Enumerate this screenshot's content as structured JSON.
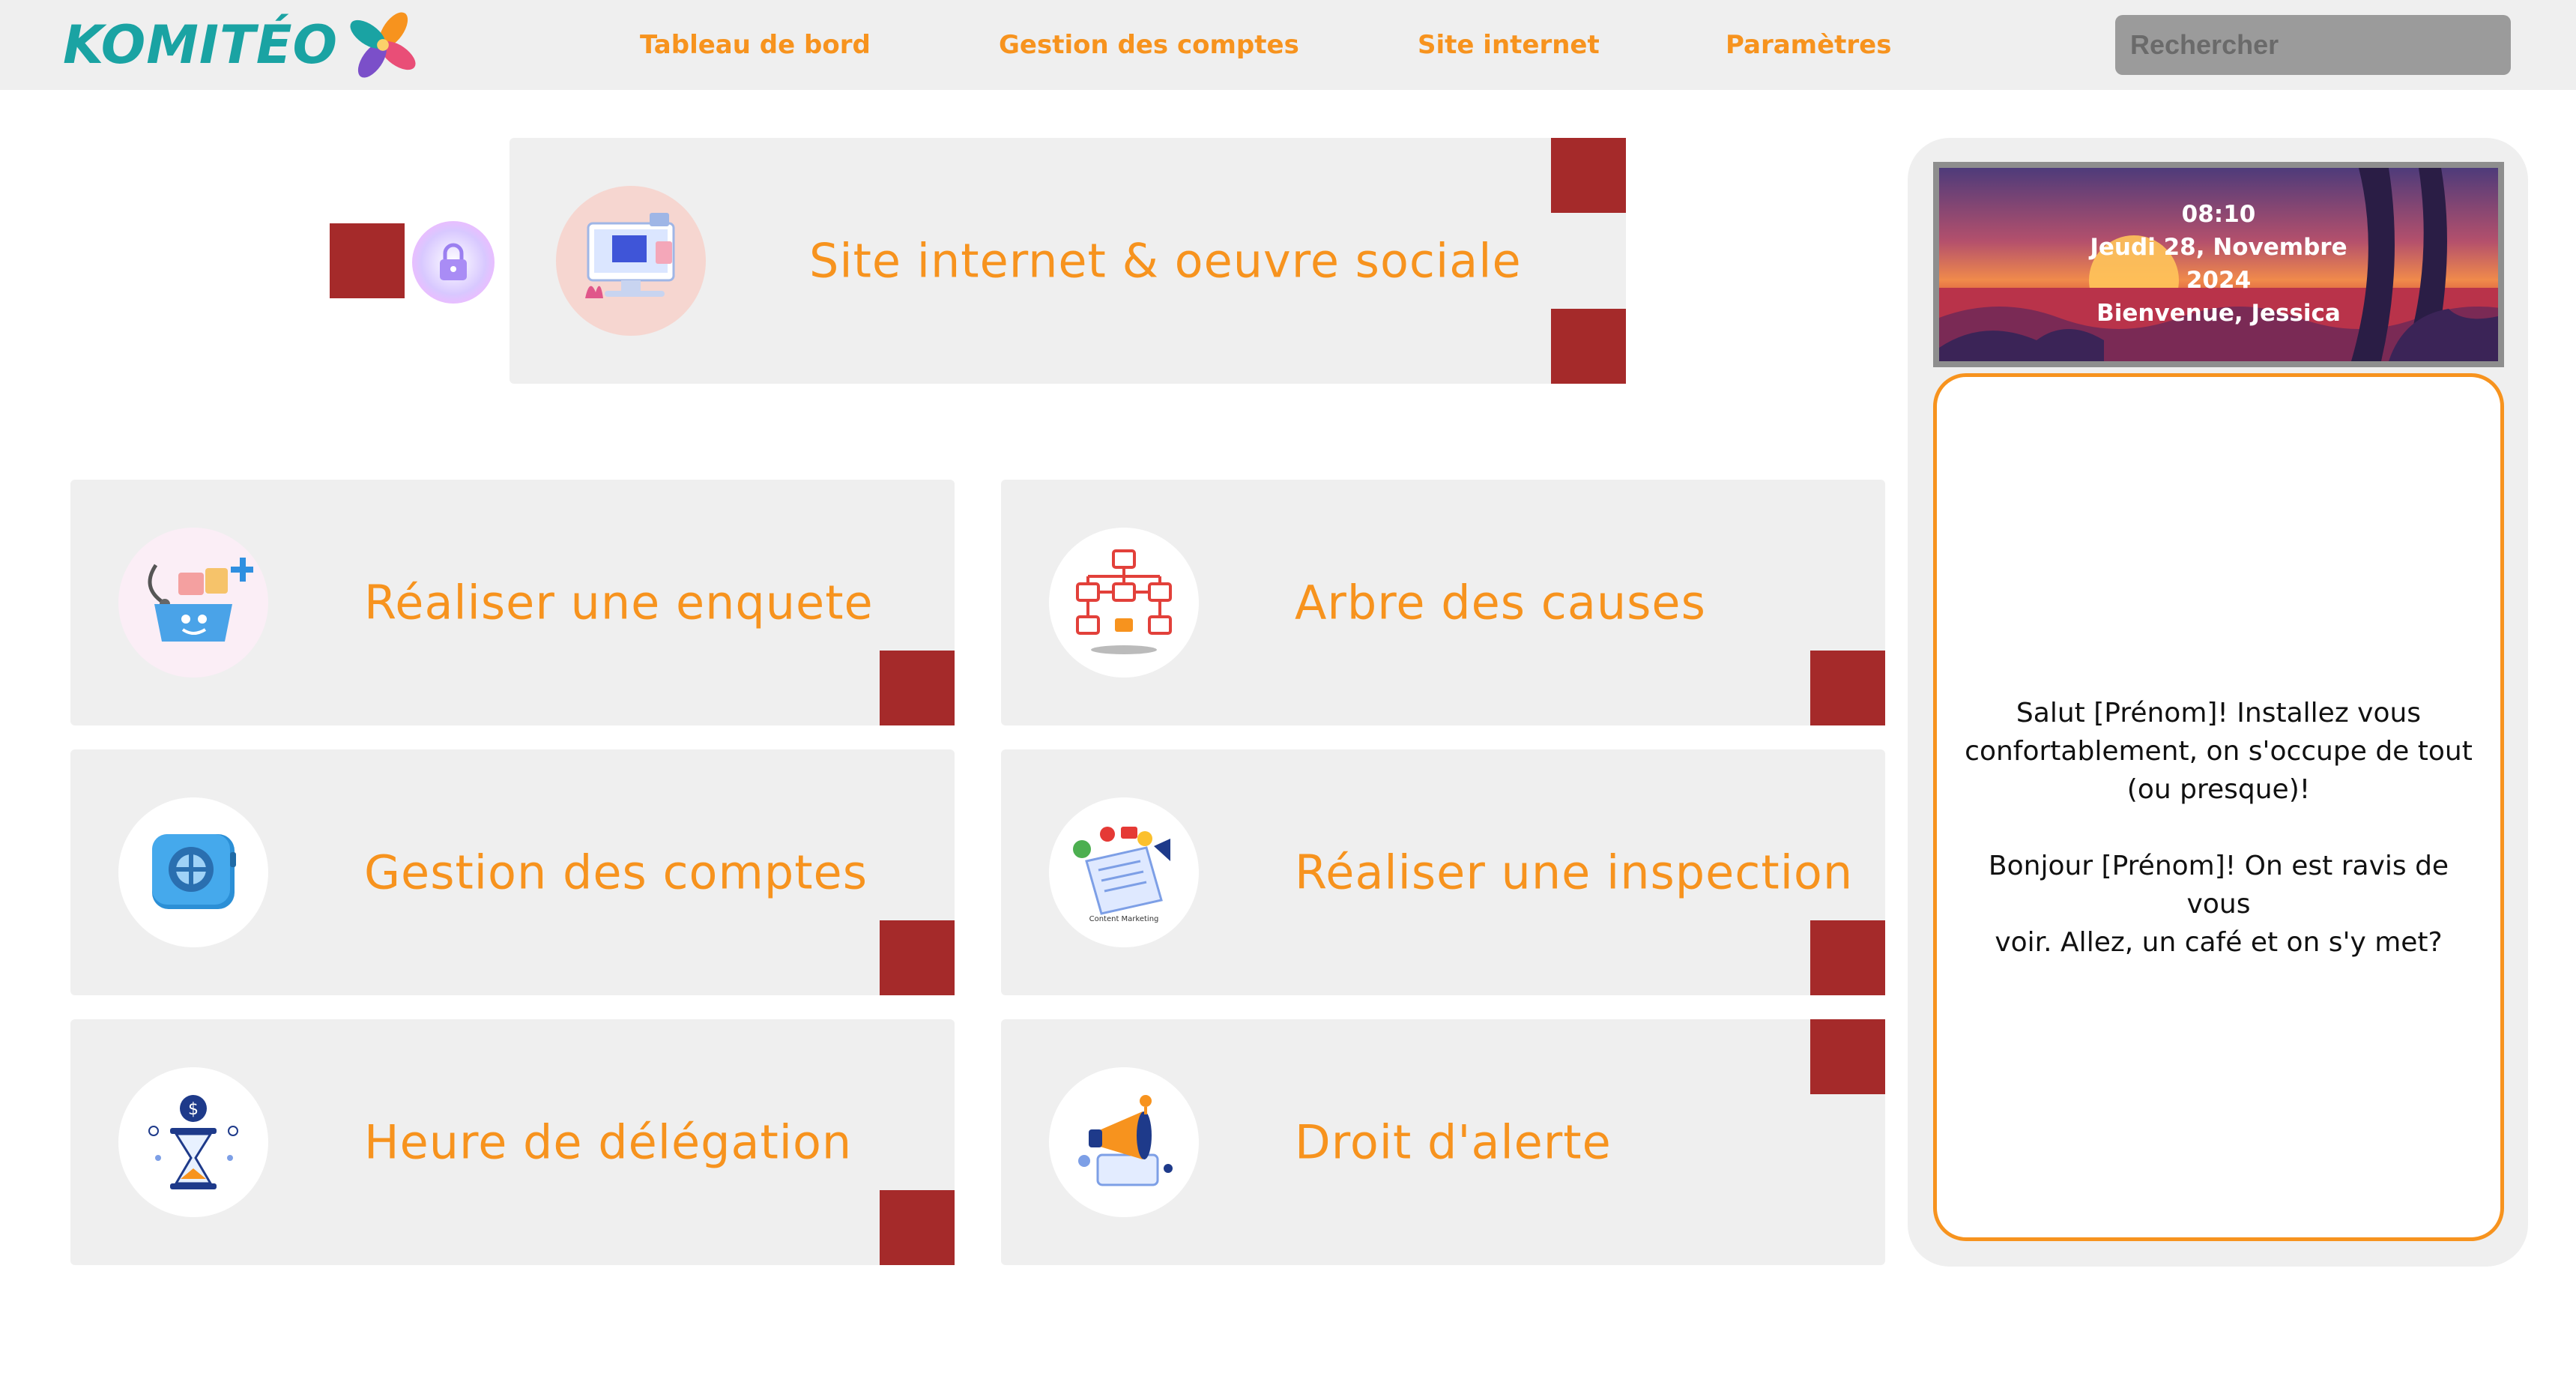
{
  "brand": {
    "name": "KOMITÉO",
    "colors": {
      "accent": "#f7931e",
      "teal": "#1aa3a3",
      "marker": "#a52a2a",
      "card_bg": "#efefef"
    }
  },
  "nav": {
    "items": [
      {
        "label": "Tableau de bord"
      },
      {
        "label": "Gestion des comptes"
      },
      {
        "label": "Site internet"
      },
      {
        "label": "Paramètres"
      }
    ],
    "search_placeholder": "Rechercher"
  },
  "hero": {
    "title": "Site internet & oeuvre sociale",
    "icon": "website-illustration-icon",
    "lock_icon": "lock-icon"
  },
  "cards": [
    {
      "title": "Réaliser une enquete",
      "icon": "medical-basket-icon"
    },
    {
      "title": "Arbre des causes",
      "icon": "flowchart-icon"
    },
    {
      "title": "Gestion des comptes",
      "icon": "safe-vault-icon"
    },
    {
      "title": "Réaliser une inspection",
      "icon": "content-marketing-icon"
    },
    {
      "title": "Heure de délégation",
      "icon": "hourglass-dollar-icon"
    },
    {
      "title": "Droit d'alerte",
      "icon": "megaphone-icon"
    }
  ],
  "sidebar": {
    "time": "08:10",
    "date_line1": "Jeudi 28, Novembre",
    "date_line2": "2024",
    "welcome": "Bienvenue, Jessica",
    "message1_line1": "Salut [Prénom]! Installez vous",
    "message1_line2": "confortablement, on s'occupe de tout",
    "message1_line3": "(ou presque)!",
    "message2_line1": "Bonjour [Prénom]! On est ravis de vous",
    "message2_line2": "voir. Allez, un café et on s'y met?"
  }
}
